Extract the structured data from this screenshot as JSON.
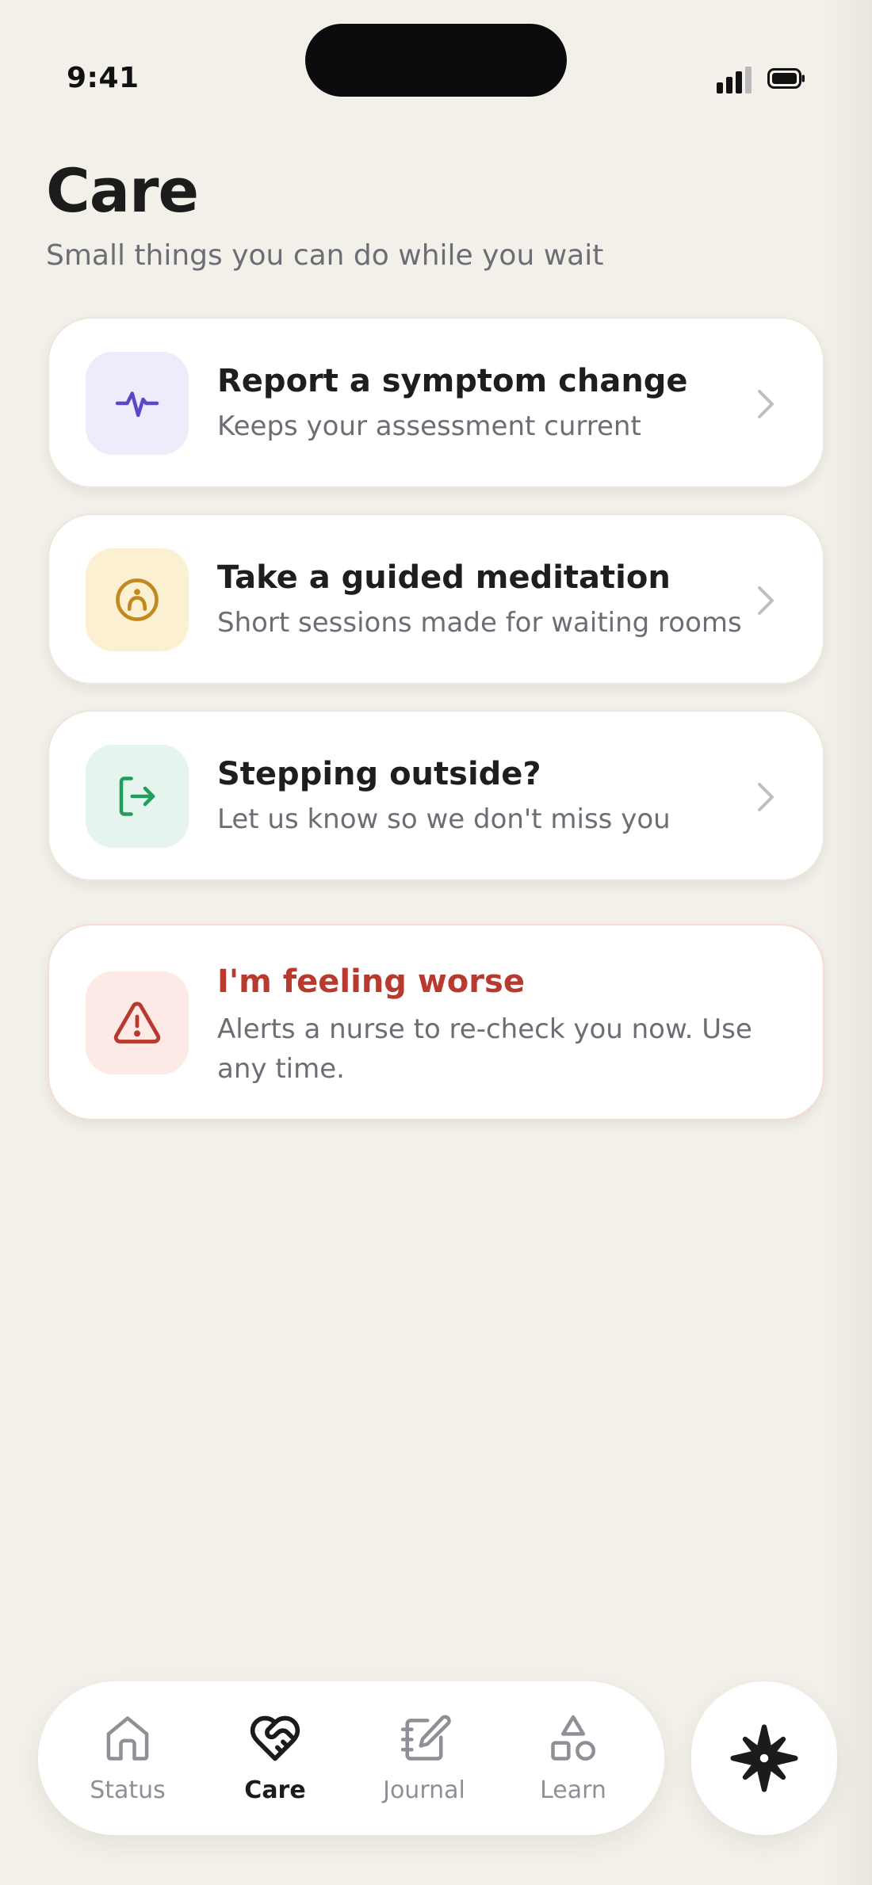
{
  "status_bar": {
    "time": "9:41"
  },
  "header": {
    "title": "Care",
    "subtitle": "Small things you can do while you wait"
  },
  "cards": [
    {
      "title": "Report a symptom change",
      "description": "Keeps your assessment current",
      "icon": "activity-pulse-icon",
      "tile_color": "#efebfb",
      "icon_color": "#5b48c9"
    },
    {
      "title": "Take a guided meditation",
      "description": "Short sessions made for waiting rooms",
      "icon": "meditation-icon",
      "tile_color": "#fbf0d2",
      "icon_color": "#c28a1e"
    },
    {
      "title": "Stepping outside?",
      "description": "Let us know so we don't miss you",
      "icon": "exit-door-icon",
      "tile_color": "#e5f4ec",
      "icon_color": "#1f9d5c"
    },
    {
      "title": "I'm feeling worse",
      "description": "Alerts a nurse to re-check you now. Use any time.",
      "icon": "warning-triangle-icon",
      "tile_color": "#fde9e6",
      "icon_color": "#b83a2e"
    }
  ],
  "tabbar": {
    "active": "Care",
    "tabs": [
      {
        "label": "Status",
        "icon": "home-icon"
      },
      {
        "label": "Care",
        "icon": "heart-handshake-icon"
      },
      {
        "label": "Journal",
        "icon": "journal-edit-icon"
      },
      {
        "label": "Learn",
        "icon": "shapes-icon"
      }
    ]
  },
  "fab": {
    "icon": "compass-star-icon"
  }
}
